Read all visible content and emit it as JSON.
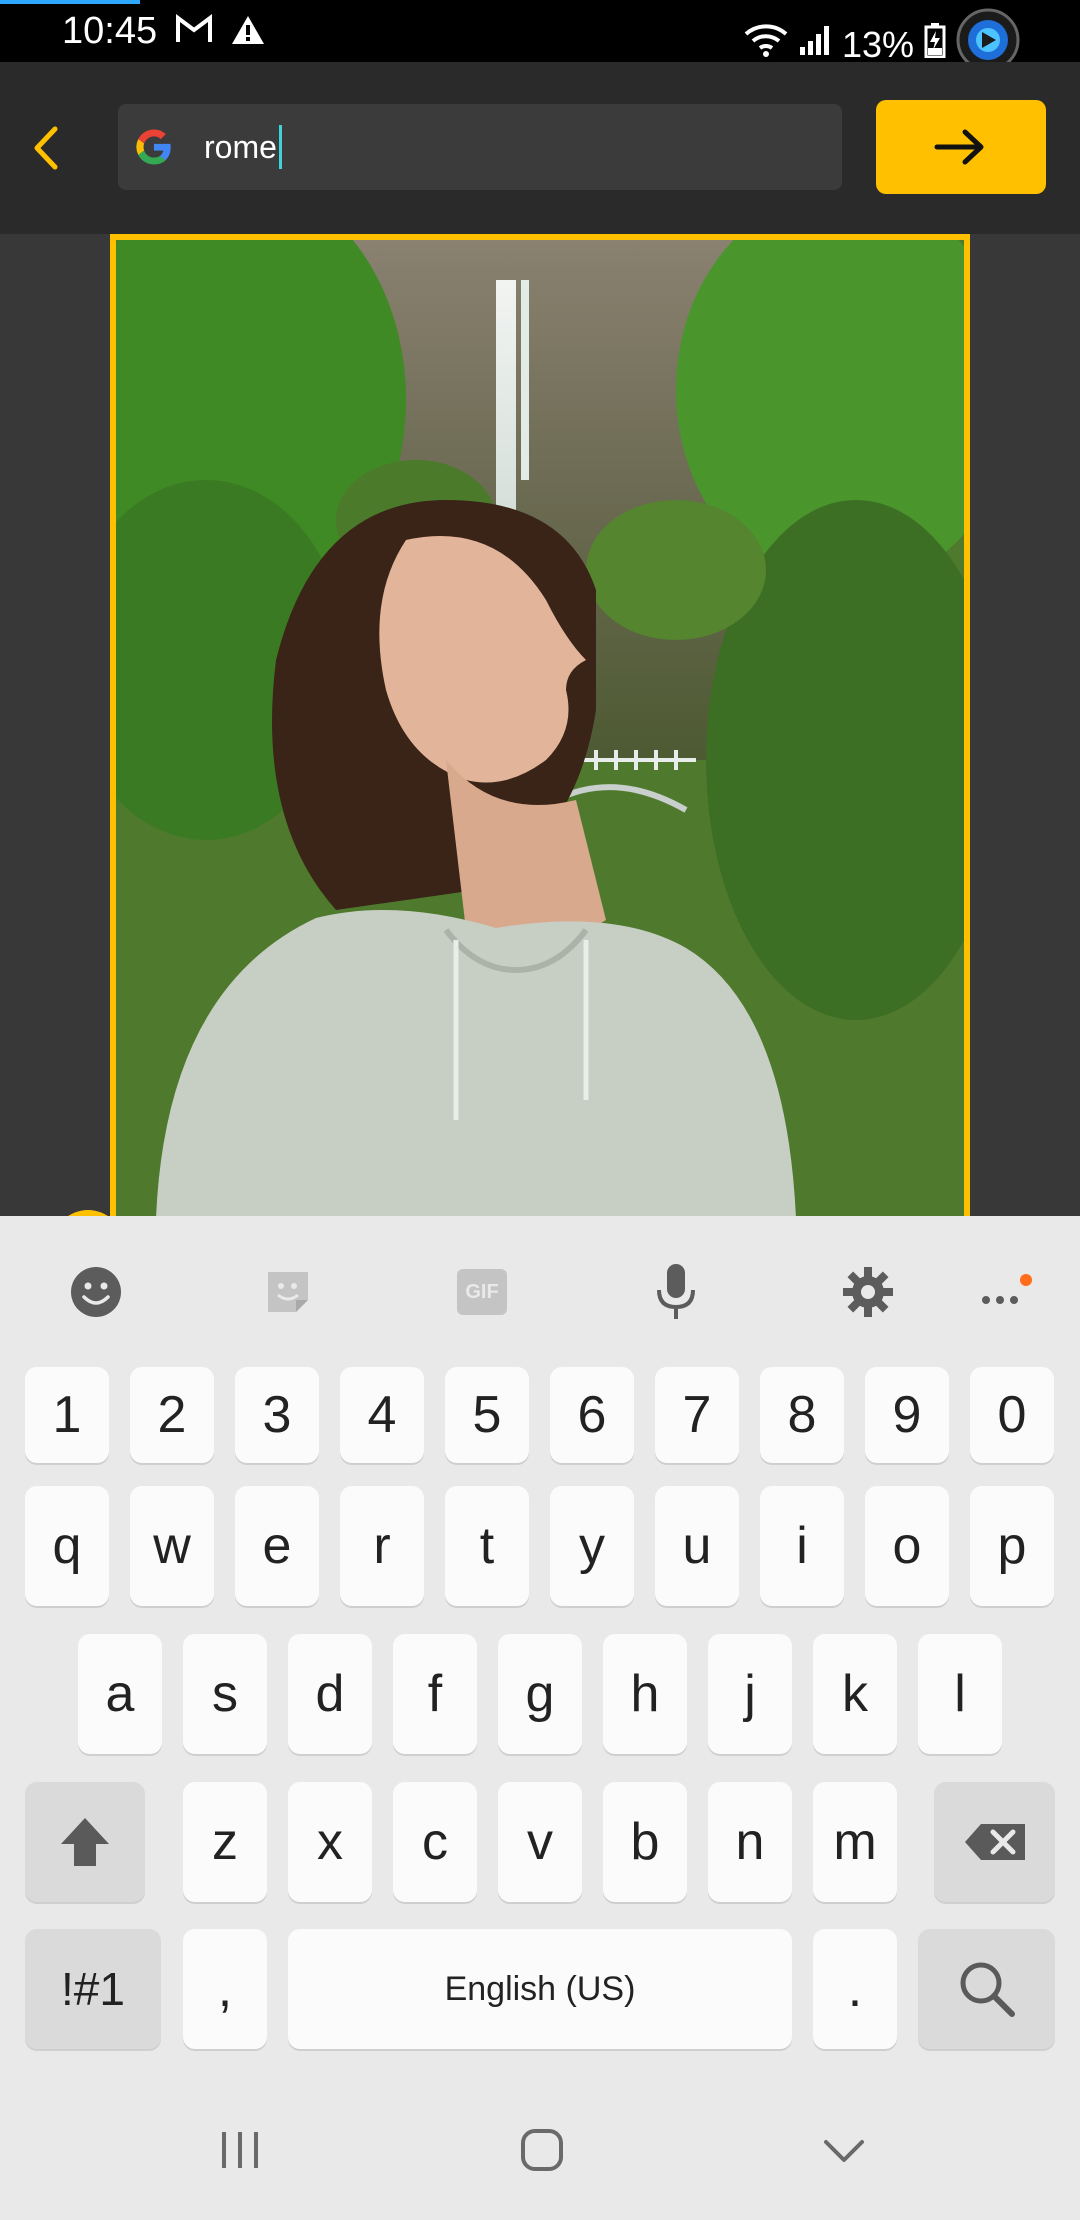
{
  "status_bar": {
    "time": "10:45",
    "battery": "13%",
    "icons": [
      "gmail-icon",
      "alert-icon",
      "wifi-icon",
      "signal-icon",
      "battery-charging-icon",
      "app-overlay-icon"
    ]
  },
  "search": {
    "value": "rome",
    "engine_icon": "google-g-icon"
  },
  "colors": {
    "accent": "#ffc000",
    "background": "#383838",
    "toolbar": "#2a2a2a"
  },
  "keyboard": {
    "toolbar_icons": [
      "emoji-icon",
      "sticker-icon",
      "gif-icon",
      "microphone-icon",
      "gear-icon",
      "more-icon"
    ],
    "gif_label": "GIF",
    "number_row": [
      "1",
      "2",
      "3",
      "4",
      "5",
      "6",
      "7",
      "8",
      "9",
      "0"
    ],
    "row1": [
      "q",
      "w",
      "e",
      "r",
      "t",
      "y",
      "u",
      "i",
      "o",
      "p"
    ],
    "row2": [
      "a",
      "s",
      "d",
      "f",
      "g",
      "h",
      "j",
      "k",
      "l"
    ],
    "row3": [
      "z",
      "x",
      "c",
      "v",
      "b",
      "n",
      "m"
    ],
    "symbols_label": "!#1",
    "comma_label": ",",
    "space_label": "English (US)",
    "period_label": "."
  },
  "nav_bar": {
    "icons": [
      "recents-icon",
      "home-icon",
      "back-chevron-icon"
    ]
  }
}
